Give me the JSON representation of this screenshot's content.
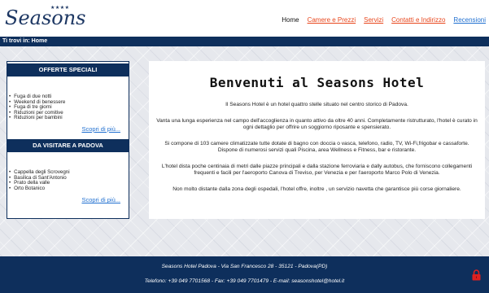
{
  "header": {
    "logo": "Seasons",
    "logo_stars": "★★★★",
    "nav": {
      "home": "Home",
      "rooms": "Camere e Prezzi",
      "services": "Servizi",
      "contacts": "Contatti e Indirizzo",
      "reviews": "Recensioni"
    }
  },
  "breadcrumb": "Ti trovi in: Home",
  "sidebar": {
    "offers": {
      "title": "OFFERTE SPECIALI",
      "items": [
        "Fuga di due notti",
        "Weekend di benessere",
        "Fuga di tre giorni",
        "Riduzioni per comitive",
        "Riduzioni per bambini"
      ],
      "more": "Scopri di più..."
    },
    "visit": {
      "title": "DA VISITARE A PADOVA",
      "items": [
        "Cappella degli Scrovegni",
        "Basilica di Sant'Antonio",
        "Prato della valle",
        "Orto Botanico"
      ],
      "more": "Scopri di più..."
    }
  },
  "main": {
    "title": "Benvenuti al Seasons Hotel",
    "paragraphs": [
      "Il Seasons Hotel è un hotel quattro stelle situato nel centro storico di Padova.",
      "Vanta una lunga esperienza nel campo dell'accoglienza in quanto attivo da oltre 40 anni. Completamente ristrutturato, l'hotel è curato in ogni dettaglio per offrire un soggiorno riposante e spensierato.",
      "Si compone di 103 camere climatizzate tutte dotate di bagno con doccia o vasca, telefono, radio, TV, Wi-Fi,frigobar e cassaforte. Dispone di numerosi servizi quali Piscina, area Wellness e Fitness, bar e ristorante.",
      "L'hotel dista poche centinaia di metri dalle piazze principali e dalla stazione ferroviaria e dally autobus, che forniscono collegamenti frequenti e facili per l'aeroporto Canova di Treviso, per Venezia e per l'aeroporto Marco Polo di Venezia.",
      "Non molto distante dalla zona degli ospedali, l'hotel offre, inoltre , un servizio navetta che garantisce più corse giornaliere."
    ]
  },
  "footer": {
    "address": "Seasons Hotel Padova - Via San Francesco 28 - 35121 - Padova(PD)",
    "contact": "Telefono: +39 049 7701568 - Fax: +39 049 7701479 - E-mail: seasonshotel@hotel.it",
    "lock_icon": "padlock-icon",
    "lock_color": "#e02020"
  },
  "colors": {
    "navy": "#0e2f5c",
    "orange_link": "#e8461c",
    "blue_link": "#1f6fd0"
  }
}
